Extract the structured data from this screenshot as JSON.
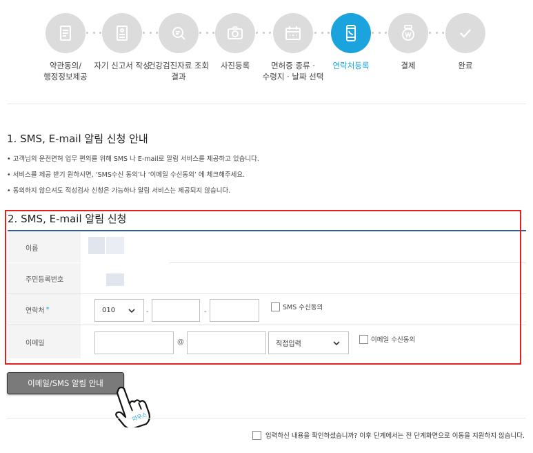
{
  "steps": [
    {
      "label": "약관동의/\n행정정보제공",
      "icon": "document-icon",
      "active": false
    },
    {
      "label": "자기 신고서 작성",
      "icon": "form-icon",
      "active": false
    },
    {
      "label": "건강검진자료 조회\n결과",
      "icon": "search-document-icon",
      "active": false
    },
    {
      "label": "사진등록",
      "icon": "camera-icon",
      "active": false
    },
    {
      "label": "면허증 종류 ·\n수령지 · 날짜 선택",
      "icon": "calendar-icon",
      "active": false
    },
    {
      "label": "연락처등록",
      "icon": "phone-icon",
      "active": true
    },
    {
      "label": "결제",
      "icon": "won-coin-icon",
      "active": false
    },
    {
      "label": "완료",
      "icon": "check-icon",
      "active": false
    }
  ],
  "section1": {
    "title": "1. SMS, E-mail 알림 신청 안내",
    "bullets": [
      "• 고객님의 운전면허 업무 편의를 위해 SMS 나 E-mail로 알림 서비스를 제공하고 있습니다.",
      "• 서비스를 제공 받기 원하시면, ‘SMS수신 동의’나 ‘이메일 수신동의’ 에 체크해주세요.",
      "• 동의하지 않으셔도 적성검사 신청은 가능하나 알림 서비스는 제공되지 않습니다."
    ]
  },
  "section2": {
    "title": "2. SMS, E-mail 알림 신청",
    "name_label": "이름",
    "rrn_label": "주민등록번호",
    "phone_label": "연락처",
    "required_mark": "*",
    "phone_prefix": "010",
    "phone_sep": "-",
    "sms_consent": "SMS 수신동의",
    "email_label": "이메일",
    "email_at": "@",
    "domain_select": "직접입력",
    "email_consent": "이메일 수신동의"
  },
  "notice_button": "이메일/SMS 알림 안내",
  "hand_caption": "마우스",
  "confirm_text": "입력하신 내용을 확인하셨습니까? 이후 단계에서는 전 단계화면으로 이동을 지원하지 않습니다.",
  "colors": {
    "accent": "#1aa3dc",
    "highlight_border": "#e02020",
    "inactive_step": "#dcdcdc"
  }
}
